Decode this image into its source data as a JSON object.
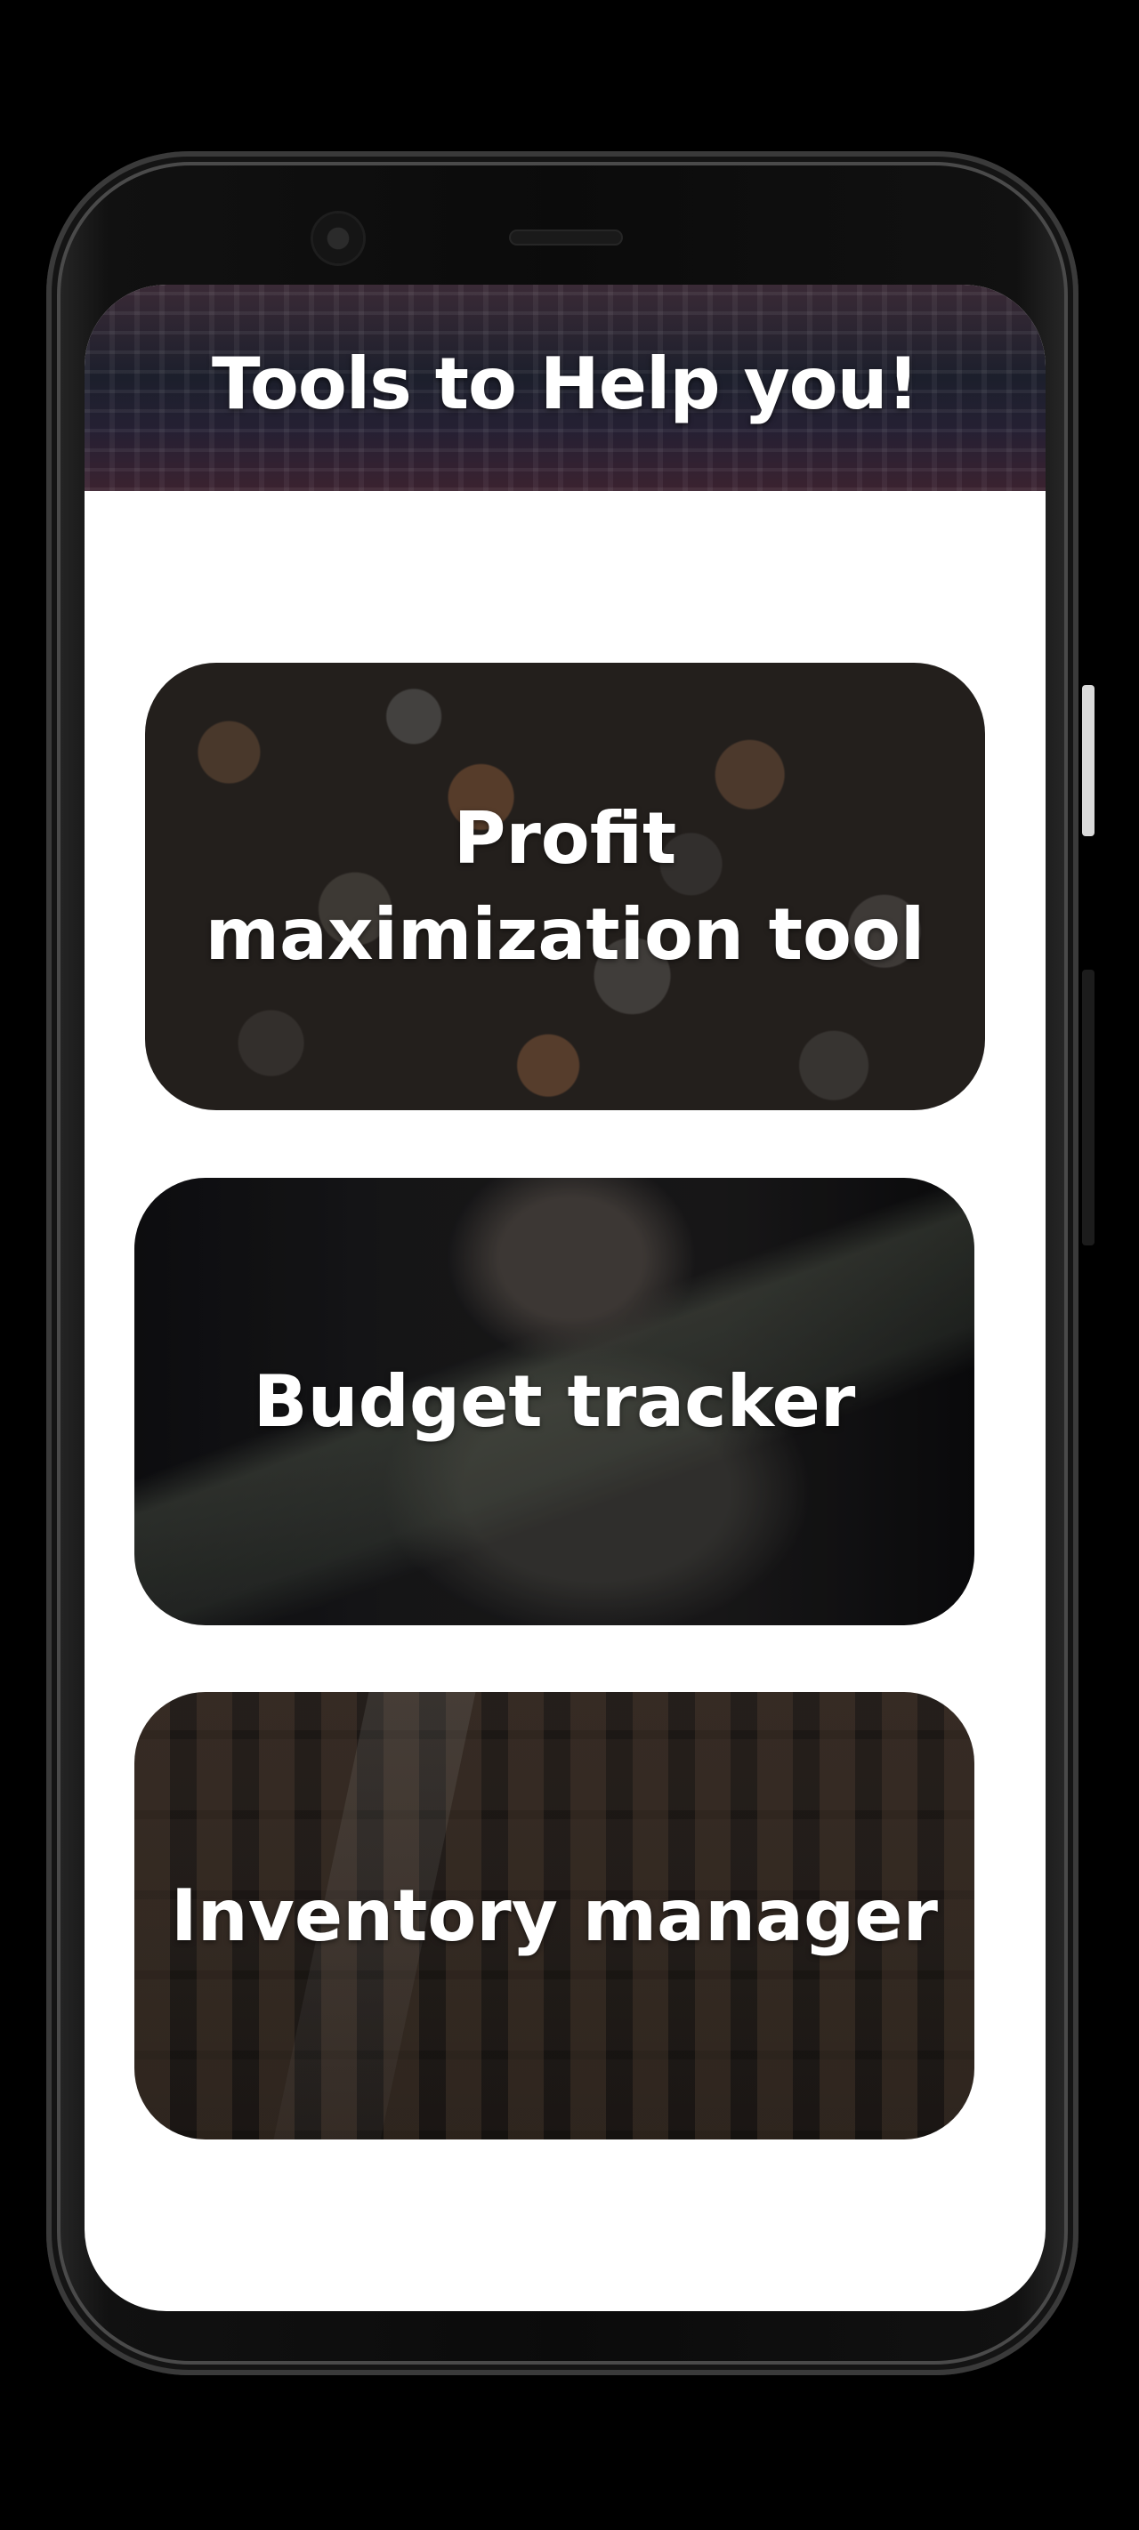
{
  "header": {
    "title": "Tools to Help you!"
  },
  "tools": [
    {
      "id": "profit",
      "label": "Profit maximization tool"
    },
    {
      "id": "budget",
      "label": "Budget tracker"
    },
    {
      "id": "inventory",
      "label": "Inventory manager"
    }
  ]
}
